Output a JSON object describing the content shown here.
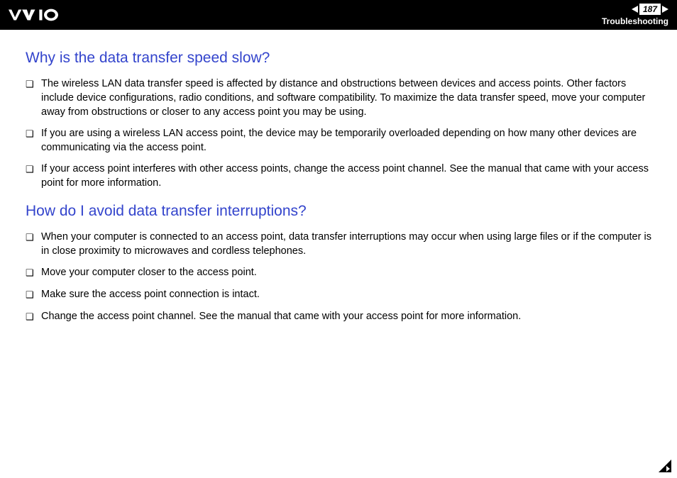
{
  "header": {
    "page_number": "187",
    "section": "Troubleshooting"
  },
  "sections": [
    {
      "heading": "Why is the data transfer speed slow?",
      "items": [
        "The wireless LAN data transfer speed is affected by distance and obstructions between devices and access points. Other factors include device configurations, radio conditions, and software compatibility. To maximize the data transfer speed, move your computer away from obstructions or closer to any access point you may be using.",
        "If you are using a wireless LAN access point, the device may be temporarily overloaded depending on how many other devices are communicating via the access point.",
        "If your access point interferes with other access points, change the access point channel. See the manual that came with your access point for more information."
      ]
    },
    {
      "heading": "How do I avoid data transfer interruptions?",
      "items": [
        "When your computer is connected to an access point, data transfer interruptions may occur when using large files or if the computer is in close proximity to microwaves and cordless telephones.",
        "Move your computer closer to the access point.",
        "Make sure the access point connection is intact.",
        "Change the access point channel. See the manual that came with your access point for more information."
      ]
    }
  ]
}
